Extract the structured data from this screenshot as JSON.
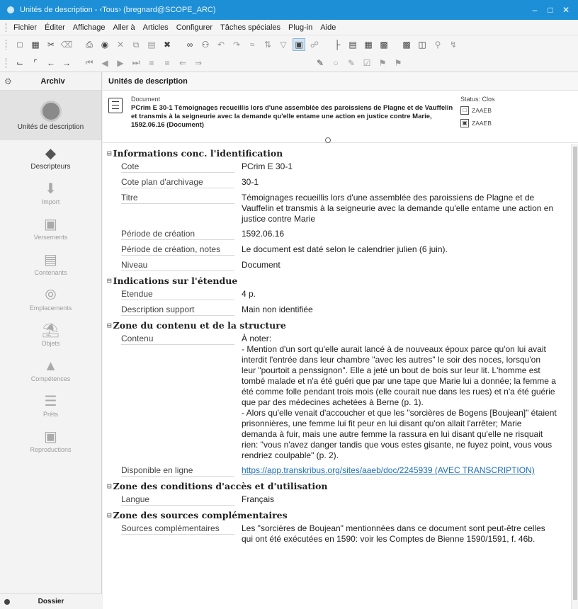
{
  "window": {
    "title": "Unités de description - ‹Tous› (bregnard@SCOPE_ARC)",
    "min": "–",
    "max": "□",
    "close": "✕"
  },
  "menu": [
    "Fichier",
    "Éditer",
    "Affichage",
    "Aller à",
    "Articles",
    "Configurer",
    "Tâches spéciales",
    "Plug-in",
    "Aide"
  ],
  "sidebar": {
    "header": "Archiv",
    "items": [
      {
        "label": "Unités de description",
        "icon": "fingerprint-icon",
        "active": true
      },
      {
        "label": "Descripteurs",
        "icon": "tag-icon",
        "active": false
      },
      {
        "label": "Import",
        "icon": "import-icon",
        "dim": true
      },
      {
        "label": "Versements",
        "icon": "inbox-icon",
        "dim": true
      },
      {
        "label": "Contenants",
        "icon": "box-icon",
        "dim": true
      },
      {
        "label": "Emplacements",
        "icon": "compass-icon",
        "dim": true
      },
      {
        "label": "Objets",
        "icon": "museum-icon",
        "dim": true
      },
      {
        "label": "Compétences",
        "icon": "graduation-cap-icon",
        "dim": true
      },
      {
        "label": "Prêts",
        "icon": "loan-icon",
        "dim": true
      },
      {
        "label": "Reproductions",
        "icon": "camera-icon",
        "dim": true
      }
    ],
    "footer": "Dossier"
  },
  "main": {
    "header": "Unités de description",
    "record": {
      "type": "Document",
      "title": "PCrim E 30-1   Témoignages recueillis lors d'une assemblée des paroissiens de Plagne et de Vauffelin et transmis à la seigneurie avec la demande qu'elle entame une action en justice contre Marie, 1592.06.16 (Document)",
      "status": "Status: Clos",
      "owner1": "ZAAEB",
      "owner2": "ZAAEB"
    },
    "sections": [
      {
        "title": "Informations conc. l'identification",
        "rows": [
          {
            "label": "Cote",
            "value": "PCrim E 30-1"
          },
          {
            "label": "Cote plan d'archivage",
            "value": "30-1"
          },
          {
            "label": "Titre",
            "value": "Témoignages recueillis lors d'une assemblée des paroissiens de Plagne et de Vauffelin et transmis à la seigneurie avec la demande qu'elle entame une action en justice contre Marie"
          },
          {
            "label": "Période de création",
            "value": "1592.06.16"
          },
          {
            "label": "Période de création, notes",
            "value": "Le document est daté selon le calendrier julien (6 juin)."
          },
          {
            "label": "Niveau",
            "value": "Document"
          }
        ]
      },
      {
        "title": "Indications sur l'étendue",
        "rows": [
          {
            "label": "Etendue",
            "value": "4 p."
          },
          {
            "label": "Description support",
            "value": "Main non identifiée"
          }
        ]
      },
      {
        "title": "Zone du contenu et de la structure",
        "rows": [
          {
            "label": "Contenu",
            "value": "À noter:\n- Mention d'un sort qu'elle aurait lancé à de nouveaux époux parce qu'on lui avait interdit l'entrée dans leur chambre \"avec les autres\" le soir des noces, lorsqu'on leur \"pourtoit a penssignon\". Elle a jeté un bout de bois sur leur lit. L'homme est tombé malade et n'a été guéri que par une tape que Marie lui a donnée; la femme a été comme folle pendant trois mois (elle courait nue dans les rues) et n'a été guérie que par des médecines achetées à Berne (p. 1).\n- Alors qu'elle venait d'accoucher et que les \"sorcières de Bogens [Boujean]\" étaient prisonnières, une femme lui fit peur en lui disant qu'on allait l'arrêter; Marie demanda à fuir, mais une autre femme la rassura en lui disant qu'elle ne risquait rien: \"vous n'avez danger tandis que vous estes gisante, ne fuyez point, vous vous rendriez coulpable\" (p. 2)."
          },
          {
            "label": "Disponible en ligne",
            "value": "https://app.transkribus.org/sites/aaeb/doc/2245939 (AVEC TRANSCRIPTION)",
            "link": true
          }
        ]
      },
      {
        "title": "Zone des conditions d'accès et d'utilisation",
        "rows": [
          {
            "label": "Langue",
            "value": "Français"
          }
        ]
      },
      {
        "title": "Zone des sources complémentaires",
        "rows": [
          {
            "label": "Sources complémentaires",
            "value": "Les \"sorcières de Boujean\" mentionnées dans ce document sont peut-être celles qui ont été exécutées en 1590: voir les Comptes de Bienne 1590/1591, f. 46b."
          }
        ]
      }
    ]
  }
}
